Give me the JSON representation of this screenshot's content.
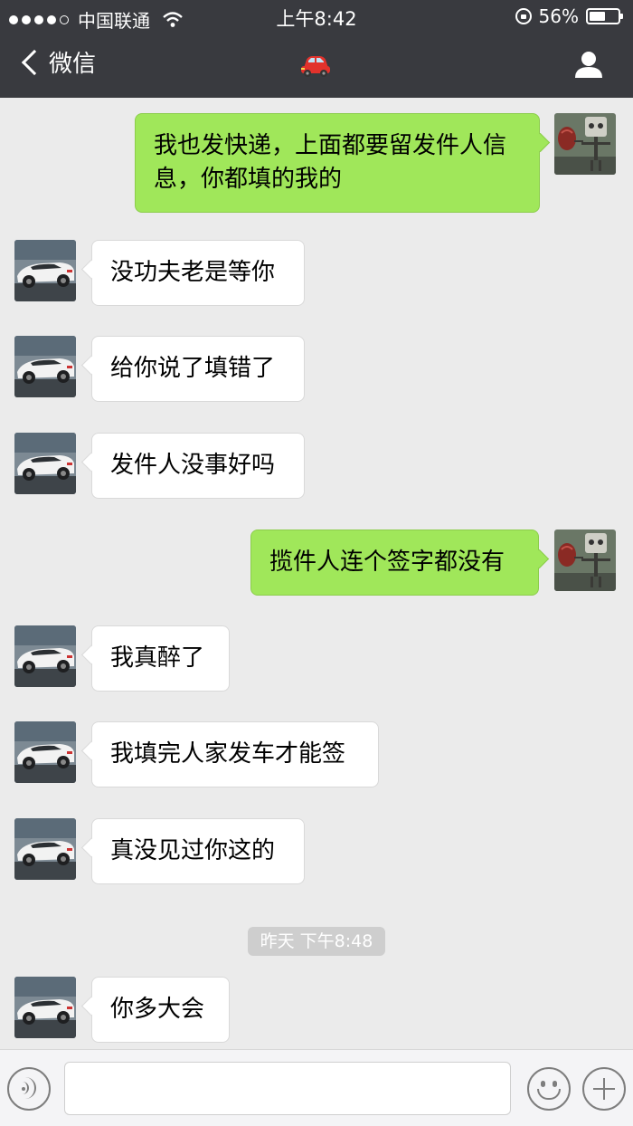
{
  "status_bar": {
    "carrier": "中国联通",
    "time": "上午8:42",
    "battery": "56%",
    "battery_level": 0.56,
    "icons": [
      "signal-dots-icon",
      "wifi-icon",
      "orientation-lock-icon",
      "battery-icon"
    ]
  },
  "nav": {
    "back_label": "微信",
    "title_icon": "car-emoji-icon",
    "right_icon": "contact-person-icon",
    "colors": {
      "bar": "#393a3f"
    }
  },
  "messages": [
    {
      "side": "right",
      "text": "我也发快递，上面都要留发件人信息，你都填的我的"
    },
    {
      "side": "left",
      "text": "没功夫老是等你"
    },
    {
      "side": "left",
      "text": "给你说了填错了"
    },
    {
      "side": "left",
      "text": "发件人没事好吗"
    },
    {
      "side": "right",
      "text": "揽件人连个签字都没有"
    },
    {
      "side": "left",
      "text": "我真醉了"
    },
    {
      "side": "left",
      "text": "我填完人家发车才能签"
    },
    {
      "side": "left",
      "text": "真没见过你这的"
    },
    {
      "side": "left",
      "text": "你多大会"
    }
  ],
  "timestamp": "昨天 下午8:48",
  "input_bar": {
    "icons": [
      "voice-icon",
      "emoji-icon",
      "plus-icon"
    ],
    "text_value": ""
  },
  "colors": {
    "background": "#ebebeb",
    "bubble_sent": "#a0e75a",
    "bubble_received": "#ffffff"
  }
}
